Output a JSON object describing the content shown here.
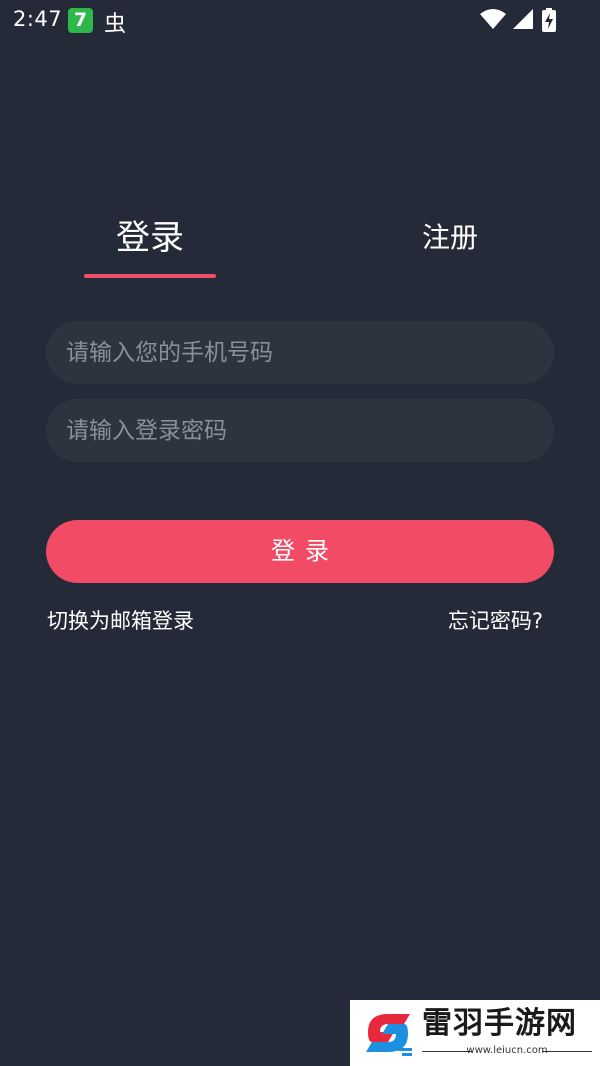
{
  "status_bar": {
    "time": "2:47",
    "notif_app_badge": "7",
    "notif_bug_glyph": "虫",
    "icons": [
      "wifi-icon",
      "signal-icon",
      "battery-charging-icon"
    ]
  },
  "tabs": {
    "login": "登录",
    "register": "注册"
  },
  "form": {
    "phone_placeholder": "请输入您的手机号码",
    "phone_value": "",
    "password_placeholder": "请输入登录密码",
    "password_value": ""
  },
  "login_button_label": "登录",
  "links": {
    "switch_to_email": "切换为邮箱登录",
    "forgot_password": "忘记密码?"
  },
  "watermark": {
    "title": "雷羽手游网",
    "url": "www.leiucn.com"
  },
  "colors": {
    "background": "#252a38",
    "field_background": "#2e3340",
    "accent": "#f24b66",
    "placeholder": "#8a8f9c"
  }
}
